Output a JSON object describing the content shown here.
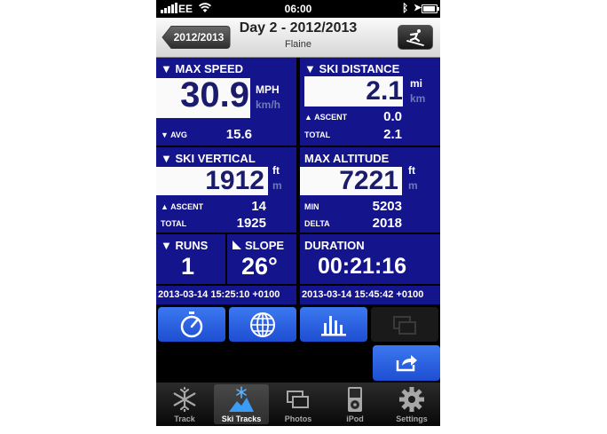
{
  "status": {
    "carrier": "EE",
    "time": "06:00"
  },
  "nav": {
    "back_label": "2012/2013",
    "title": "Day 2 - 2012/2013",
    "subtitle": "Flaine"
  },
  "panels": {
    "max_speed": {
      "title": "▼ MAX SPEED",
      "value": "30.9",
      "unit": "MPH",
      "alt_unit": "km/h",
      "avg_label": "▼ AVG",
      "avg_value": "15.6"
    },
    "ski_distance": {
      "title": "▼ SKI DISTANCE",
      "value": "2.1",
      "unit": "mi",
      "alt_unit": "km",
      "ascent_label": "▲ ASCENT",
      "ascent_value": "0.0",
      "total_label": "TOTAL",
      "total_value": "2.1"
    },
    "ski_vertical": {
      "title": "▼ SKI VERTICAL",
      "value": "1912",
      "unit": "ft",
      "alt_unit": "m",
      "ascent_label": "▲ ASCENT",
      "ascent_value": "14",
      "total_label": "TOTAL",
      "total_value": "1925"
    },
    "max_altitude": {
      "title": "MAX ALTITUDE",
      "value": "7221",
      "unit": "ft",
      "alt_unit": "m",
      "min_label": "MIN",
      "min_value": "5203",
      "delta_label": "DELTA",
      "delta_value": "2018"
    },
    "runs": {
      "title": "▼ RUNS",
      "value": "1"
    },
    "slope": {
      "title": "SLOPE",
      "value": "26°"
    },
    "duration": {
      "title": "DURATION",
      "value": "00:21:16"
    },
    "start_time": "2013-03-14 15:25:10 +0100",
    "end_time": "2013-03-14 15:45:42 +0100"
  },
  "toolbar": [
    "stopwatch-icon",
    "globe-icon",
    "bar-chart-icon",
    "photos-icon"
  ],
  "tabs": [
    {
      "label": "Track",
      "icon": "snowflake-icon"
    },
    {
      "label": "Ski Tracks",
      "icon": "snowflake-mountain-icon",
      "active": true
    },
    {
      "label": "Photos",
      "icon": "photos-icon"
    },
    {
      "label": "iPod",
      "icon": "ipod-icon"
    },
    {
      "label": "Settings",
      "icon": "gear-icon"
    }
  ],
  "colors": {
    "panel": "#14148c",
    "button": "#2f64e6",
    "background": "#000000"
  }
}
